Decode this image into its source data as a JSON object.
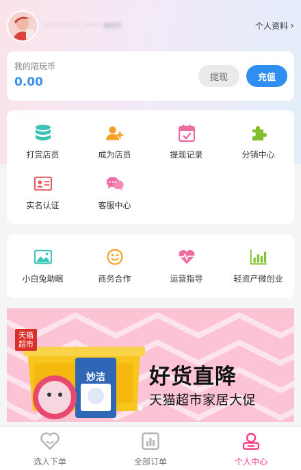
{
  "header": {
    "username": "············· ······ won",
    "profile_link": "个人资料",
    "chevron": "›"
  },
  "wallet": {
    "label": "我的陪玩币",
    "amount": "0.00",
    "withdraw_label": "提现",
    "recharge_label": "充值"
  },
  "menu_primary": [
    {
      "label": "打赏店员",
      "icon": "database-icon"
    },
    {
      "label": "成为店员",
      "icon": "add-user-icon"
    },
    {
      "label": "提现记录",
      "icon": "calendar-check-icon"
    },
    {
      "label": "分销中心",
      "icon": "puzzle-icon"
    },
    {
      "label": "实名认证",
      "icon": "id-card-icon"
    },
    {
      "label": "客服中心",
      "icon": "chat-bubbles-icon"
    }
  ],
  "menu_secondary": [
    {
      "label": "小白兔助眠",
      "icon": "image-icon"
    },
    {
      "label": "商务合作",
      "icon": "smile-icon"
    },
    {
      "label": "运营指导",
      "icon": "heartbeat-icon"
    },
    {
      "label": "轻资产微创业",
      "icon": "bar-chart-icon"
    }
  ],
  "banner": {
    "badge": "天猫超市",
    "product_brand": "妙洁",
    "title": "好货直降",
    "subtitle": "天猫超市家居大促"
  },
  "tabbar": {
    "tabs": [
      {
        "label": "选人下单",
        "icon": "heart-smile-icon",
        "active": false
      },
      {
        "label": "全部订单",
        "icon": "order-chart-icon",
        "active": false
      },
      {
        "label": "个人中心",
        "icon": "person-icon",
        "active": true
      }
    ]
  },
  "colors": {
    "accent_blue": "#2f8ef0",
    "active_pink": "#ff3c84",
    "icon_teal": "#3cc3b5",
    "icon_orange": "#f5a024",
    "icon_pink": "#f06ba0",
    "icon_green": "#80c02e",
    "icon_red": "#e8545a"
  }
}
